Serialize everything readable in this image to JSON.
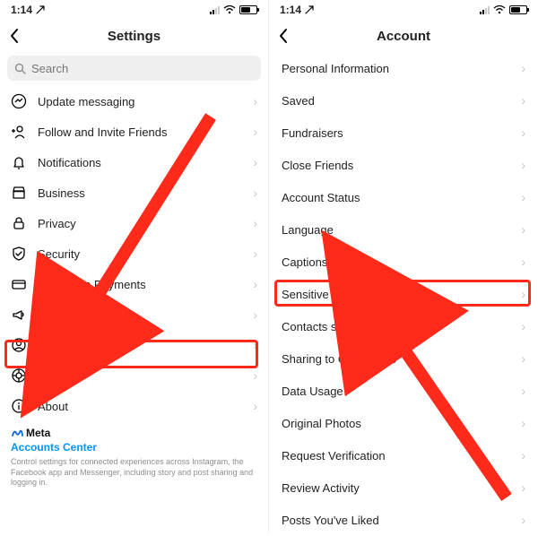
{
  "status": {
    "time": "1:14",
    "locArrow": "➚"
  },
  "left": {
    "title": "Settings",
    "searchPlaceholder": "Search",
    "items": [
      {
        "label": "Update messaging"
      },
      {
        "label": "Follow and Invite Friends"
      },
      {
        "label": "Notifications"
      },
      {
        "label": "Business"
      },
      {
        "label": "Privacy"
      },
      {
        "label": "Security"
      },
      {
        "label": "Promotion Payments"
      },
      {
        "label": "Ads"
      },
      {
        "label": "Account"
      },
      {
        "label": "Help"
      },
      {
        "label": "About"
      }
    ],
    "footer": {
      "meta": "Meta",
      "accountsCenter": "Accounts Center",
      "desc": "Control settings for connected experiences across Instagram, the Facebook app and Messenger, including story and post sharing and logging in."
    }
  },
  "right": {
    "title": "Account",
    "items": [
      {
        "label": "Personal Information"
      },
      {
        "label": "Saved"
      },
      {
        "label": "Fundraisers"
      },
      {
        "label": "Close Friends"
      },
      {
        "label": "Account Status"
      },
      {
        "label": "Language"
      },
      {
        "label": "Captions"
      },
      {
        "label": "Sensitive Content Control"
      },
      {
        "label": "Contacts syncing"
      },
      {
        "label": "Sharing to Other Apps"
      },
      {
        "label": "Data Usage"
      },
      {
        "label": "Original Photos"
      },
      {
        "label": "Request Verification"
      },
      {
        "label": "Review Activity"
      },
      {
        "label": "Posts You've Liked"
      }
    ]
  },
  "annotations": {
    "highlightLeftItem": "Account",
    "highlightRightItem": "Sensitive Content Control",
    "arrowColor": "#ff2a1a"
  }
}
